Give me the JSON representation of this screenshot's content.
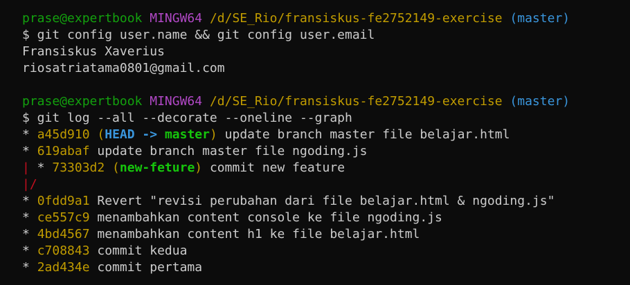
{
  "prompt1": {
    "user_host": "prase@expertbook",
    "system": "MINGW64",
    "path": "/d/SE_Rio/fransiskus-fe2752149-exercise",
    "branch": "(master)"
  },
  "command1": "$ git config user.name && git config user.email",
  "output1": {
    "name": "Fransiskus Xaverius",
    "email": "riosatriatama0801@gmail.com"
  },
  "prompt2": {
    "user_host": "prase@expertbook",
    "system": "MINGW64",
    "path": "/d/SE_Rio/fransiskus-fe2752149-exercise",
    "branch": "(master)"
  },
  "command2": "$ git log --all --decorate --oneline --graph",
  "log": {
    "c1": {
      "graph": "* ",
      "hash": "a45d910",
      "open": " (",
      "head": "HEAD -> ",
      "ref": "master",
      "close": ")",
      "msg": " update branch master file belajar.html"
    },
    "c2": {
      "graph": "* ",
      "hash": "619abaf",
      "msg": " update branch master file ngoding.js"
    },
    "c3": {
      "graph_bar": "|",
      "graph": " * ",
      "hash": "73303d2",
      "open": " (",
      "ref": "new-feture",
      "close": ")",
      "msg": " commit new feature"
    },
    "merge": {
      "graph": "|/"
    },
    "c4": {
      "graph": "* ",
      "hash": "0fdd9a1",
      "msg": " Revert \"revisi perubahan dari file belajar.html & ngoding.js\""
    },
    "c5": {
      "graph": "* ",
      "hash": "ce557c9",
      "msg": " menambahkan content console ke file ngoding.js"
    },
    "c6": {
      "graph": "* ",
      "hash": "4bd4567",
      "msg": " menambahkan content h1 ke file belajar.html"
    },
    "c7": {
      "graph": "* ",
      "hash": "c708843",
      "msg": " commit kedua"
    },
    "c8": {
      "graph": "* ",
      "hash": "2ad434e",
      "msg": " commit pertama"
    }
  },
  "colors": {
    "background": "#0c0c0c",
    "text": "#cccccc",
    "user": "#13a10e",
    "system": "#b148c6",
    "path": "#c19c00",
    "branch": "#3a96dd",
    "graph": "#c50f1f"
  }
}
